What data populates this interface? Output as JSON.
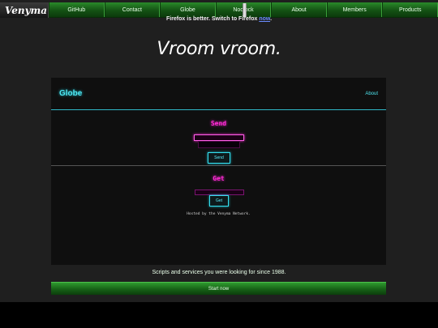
{
  "nav": {
    "brand": "Venyma",
    "items": [
      {
        "label": "GitHub"
      },
      {
        "label": "Contact"
      },
      {
        "label": "Globe"
      },
      {
        "label": "Nodlock"
      },
      {
        "label": "About"
      },
      {
        "label": "Members"
      },
      {
        "label": "Products"
      }
    ]
  },
  "banner": {
    "text": "Firefox is better. Switch to Firefox ",
    "link": "now",
    "suffix": "."
  },
  "hero": "Vroom vroom.",
  "panel": {
    "title": "Globe",
    "about_link": "About",
    "send": {
      "heading": "Send",
      "button": "Send"
    },
    "get": {
      "heading": "Get",
      "button": "Get",
      "hosted": "Hosted by the Venyma Network."
    }
  },
  "footer": {
    "tagline": "Scripts and services you were looking for since 1988.",
    "start": "Start now"
  },
  "colors": {
    "accent_cyan": "#4fe6f0",
    "accent_magenta": "#ff2bd6",
    "nav_green": "#1a6a1a"
  }
}
